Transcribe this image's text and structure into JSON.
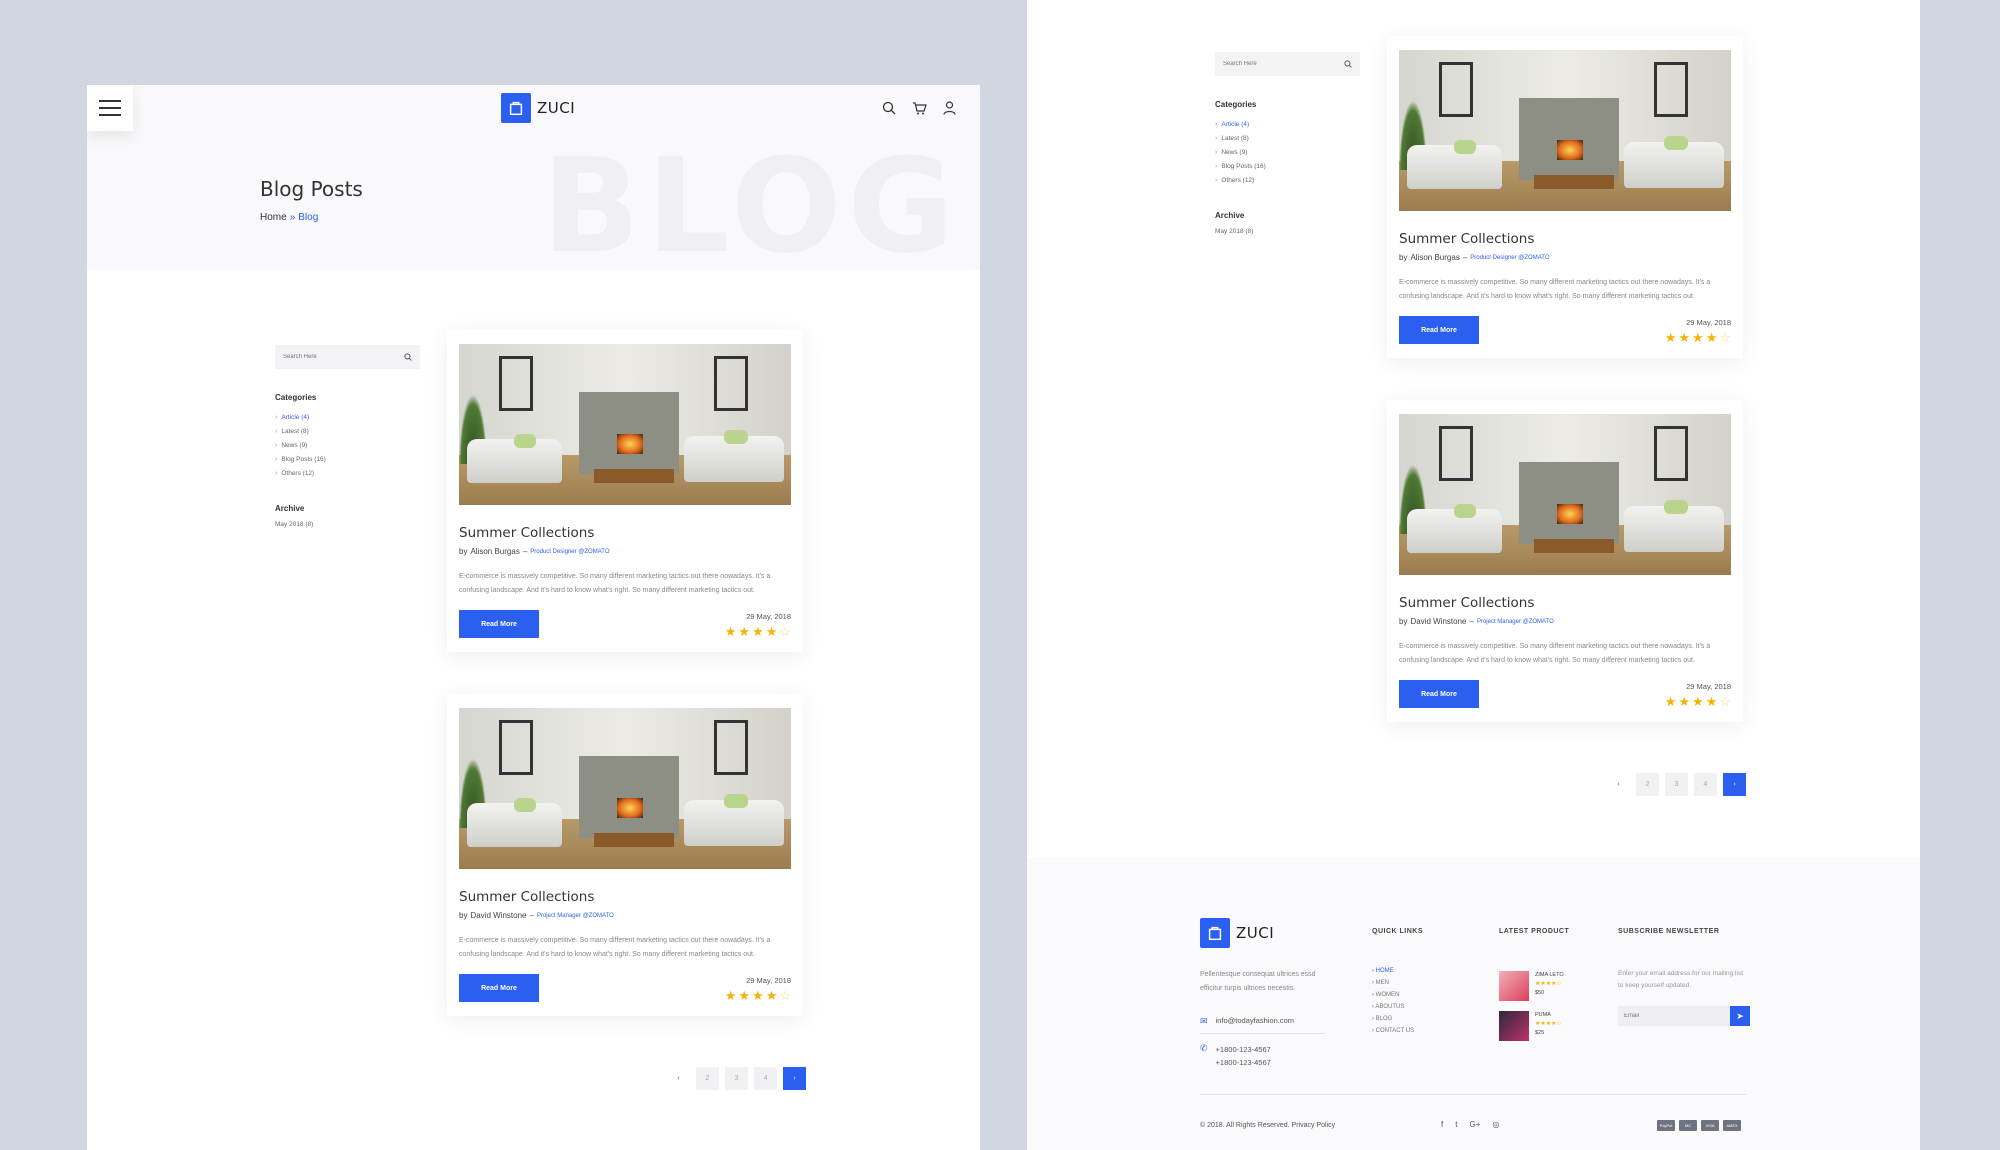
{
  "brand": {
    "name": "ZUCI",
    "accent": "#2b5ff0"
  },
  "header": {
    "watermark": "BLOG",
    "title": "Blog Posts",
    "breadcrumb": {
      "home": "Home",
      "separator": "»",
      "current": "Blog"
    },
    "icons": [
      "search-icon",
      "cart-icon",
      "user-icon"
    ]
  },
  "sidebar": {
    "search_placeholder": "Search Here",
    "categories_title": "Categories",
    "categories": [
      {
        "label": "Article (4)"
      },
      {
        "label": "Latest (8)"
      },
      {
        "label": "News (9)"
      },
      {
        "label": "Blog Posts (16)"
      },
      {
        "label": "Others (12)"
      }
    ],
    "archive_title": "Archive",
    "archive": [
      {
        "label": "May 2018 (8)"
      }
    ]
  },
  "posts": [
    {
      "title": "Summer Collections",
      "by": "by",
      "author": "Alison Burgas",
      "dash": "–",
      "role": "Product Designer @ZOMATO",
      "excerpt": "E-commerce is massively competitive. So many different marketing tactics out there nowadays. It's a confusing landscape. And it's hard to know what's right. So many different marketing tactics out.",
      "button": "Read More",
      "date": "29 May, 2018",
      "rating": 4,
      "rating_max": 5
    },
    {
      "title": "Summer Collections",
      "by": "by",
      "author": "David Winstone",
      "dash": "–",
      "role": "Project Manager @ZOMATO",
      "excerpt": "E-commerce is massively competitive. So many different marketing tactics out there nowadays. It's a confusing landscape. And it's hard to know what's right. So many different marketing tactics out.",
      "button": "Read More",
      "date": "29 May, 2018",
      "rating": 4,
      "rating_max": 5
    }
  ],
  "pagination": {
    "prev": "‹",
    "pages": [
      "2",
      "3",
      "4"
    ],
    "next": "›"
  },
  "footer": {
    "about": "Pellentesque consequat ultrices essd efficitur turpis ultrices necestis.",
    "email": "info@todayfashion.com",
    "phones": [
      "+1800-123-4567",
      "+1800-123-4567"
    ],
    "quick_links_title": "QUICK LINKS",
    "quick_links": [
      {
        "label": "HOME"
      },
      {
        "label": "MEN"
      },
      {
        "label": "WOMEN"
      },
      {
        "label": "ABOUTUS"
      },
      {
        "label": "BLOG"
      },
      {
        "label": "CONTACT US"
      }
    ],
    "latest_title": "LATEST PRODUCT",
    "products": [
      {
        "name": "ZIMA LETO",
        "stars": "★★★★☆",
        "price": "$50"
      },
      {
        "name": "PUMA",
        "stars": "★★★★☆",
        "price": "$25"
      }
    ],
    "subscribe_title": "SUBSCRIBE NEWSLETTER",
    "subscribe_text": "Enter your email address for our mailing list to keep yourself updated.",
    "email_placeholder": "Email",
    "copyright": "© 2018. All Rights Reserved. Privacy Policy",
    "socials": [
      "f",
      "t",
      "G+",
      "◎"
    ],
    "payments": [
      "PayPal",
      "MC",
      "VISA",
      "AMEX"
    ]
  }
}
